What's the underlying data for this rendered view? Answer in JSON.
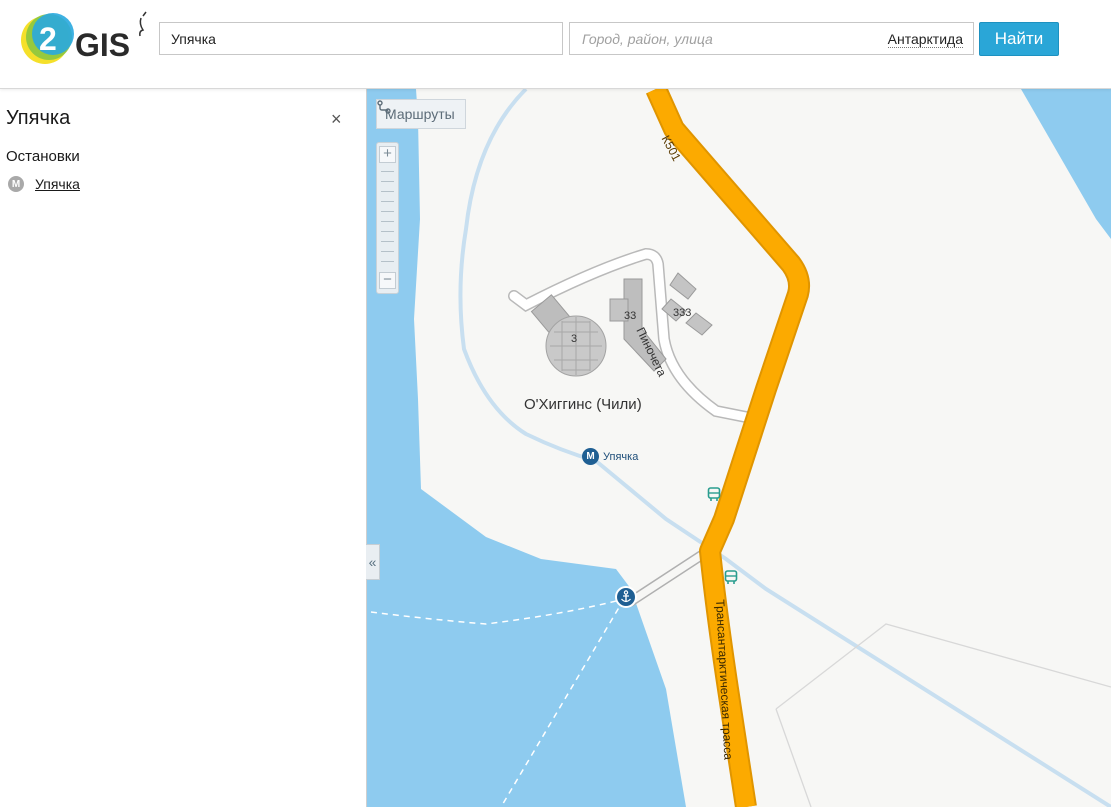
{
  "header": {
    "logo_text": "2GIS",
    "search": {
      "value": "Упячка",
      "placeholder": ""
    },
    "location": {
      "placeholder": "Город, район, улица",
      "region": "Антарктида"
    },
    "find_label": "Найти"
  },
  "sidebar": {
    "title": "Упячка",
    "close_symbol": "×",
    "section_heading": "Остановки",
    "stops": [
      {
        "label": "Упячка",
        "icon": "metro-icon"
      }
    ],
    "collapse_symbol": "«"
  },
  "map": {
    "routes_label": "Маршруты",
    "zoom_in_symbol": "+",
    "zoom_out_symbol": "−",
    "place_label": "О'Хиггинс (Чили)",
    "stop_marker_symbol": "М",
    "stop_marker_label": "Упячка",
    "road_labels": {
      "k501": "К501",
      "street": "Пиночета",
      "highway": "Трансантарктическая трасса"
    },
    "building_numbers": {
      "dome": "3",
      "b33": "33",
      "b333": "333"
    },
    "colors": {
      "water": "#8ecbef",
      "land": "#f7f7f5",
      "highway": "#fcaa00",
      "accent": "#2aa6d7",
      "marker": "#1f5f93"
    }
  }
}
